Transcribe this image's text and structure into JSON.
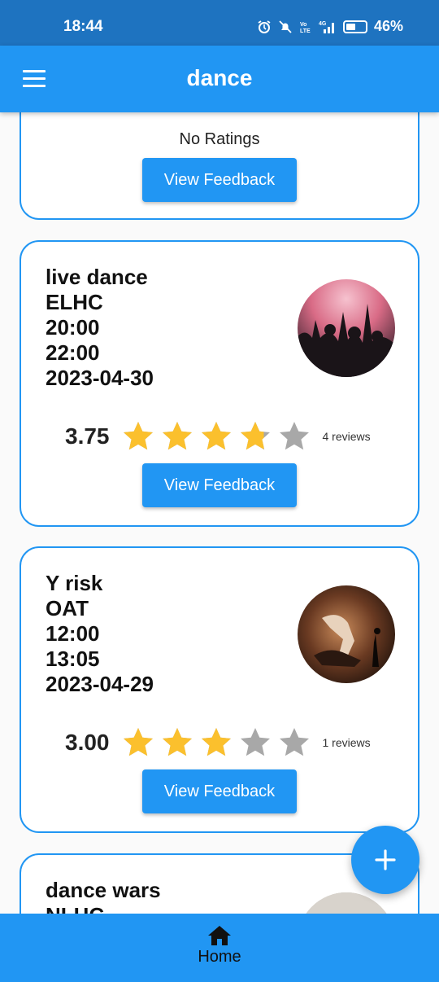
{
  "status_bar": {
    "time": "18:44",
    "battery_pct": "46%"
  },
  "app_bar": {
    "title": "dance"
  },
  "cards": [
    {
      "no_ratings_text": "No Ratings",
      "button_label": "View Feedback"
    },
    {
      "title": "live dance",
      "venue": "ELHC",
      "start": "20:00",
      "end": "22:00",
      "date": "2023-04-30",
      "rating": "3.75",
      "stars_filled": 3.75,
      "reviews": "4 reviews",
      "button_label": "View Feedback"
    },
    {
      "title": "Y risk",
      "venue": "OAT",
      "start": "12:00",
      "end": "13:05",
      "date": "2023-04-29",
      "rating": "3.00",
      "stars_filled": 3,
      "reviews": "1 reviews",
      "button_label": "View Feedback"
    },
    {
      "title": "dance wars",
      "venue": "NLHC"
    }
  ],
  "fab": {
    "icon": "plus-icon",
    "label": "+"
  },
  "bottom_nav": {
    "home_label": "Home",
    "home_icon": "home-icon"
  },
  "colors": {
    "primary": "#2196f3",
    "status_bar": "#1e73c0",
    "star_filled": "#fbc02d",
    "star_empty": "#a8a8a8"
  }
}
